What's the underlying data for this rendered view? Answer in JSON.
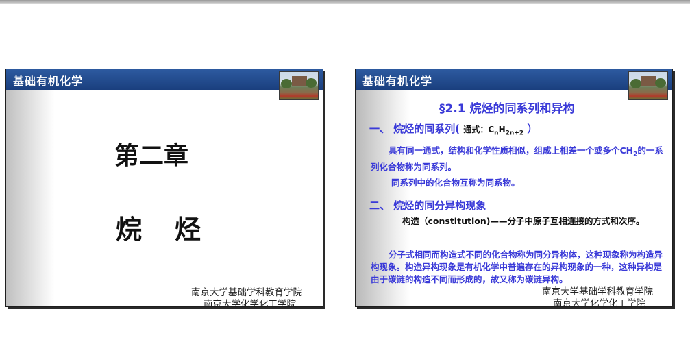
{
  "slide1": {
    "header": "基础有机化学",
    "chapter": "第二章",
    "title_char1": "烷",
    "title_char2": "烃",
    "footer_line1": "南京大学基础学科教育学院",
    "footer_line2": "南京大学化学化工学院"
  },
  "slide2": {
    "header": "基础有机化学",
    "title": "§2.1  烷烃的同系列和异构",
    "section1": {
      "heading": "一、  烷烃的同系列(",
      "formula_label": "通式：",
      "formula_c": "C",
      "formula_n": "n",
      "formula_h": "H",
      "formula_sub": "2n+2",
      "close": "）"
    },
    "para1_a": "具有同一通式，结构和化学性质相似，组成上相差一个或多个CH",
    "para1_sub": "2",
    "para1_b": "的一系列化合物称为同系列。",
    "para2": "同系列中的化合物互称为同系物。",
    "section2": {
      "heading": "二、  烷烃的同分异构现象"
    },
    "para3_label": "构造（constitution)",
    "para3_rest": "——分子中原子互相连接的方式和次序。",
    "para4": "分子式相同而构造式不同的化合物称为同分异构体，这种现象称为构造异构现象。构造异构现象是有机化学中普遍存在的异构现象的一种，这种异构是由于碳链的构造不同而形成的，故又称为碳链异构。",
    "footer_line1": "南京大学基础学科教育学院",
    "footer_line2": "南京大学化学化工学院"
  },
  "colors": {
    "header_blue": "#2d5aa0",
    "text_blue": "#3a3ad8"
  }
}
